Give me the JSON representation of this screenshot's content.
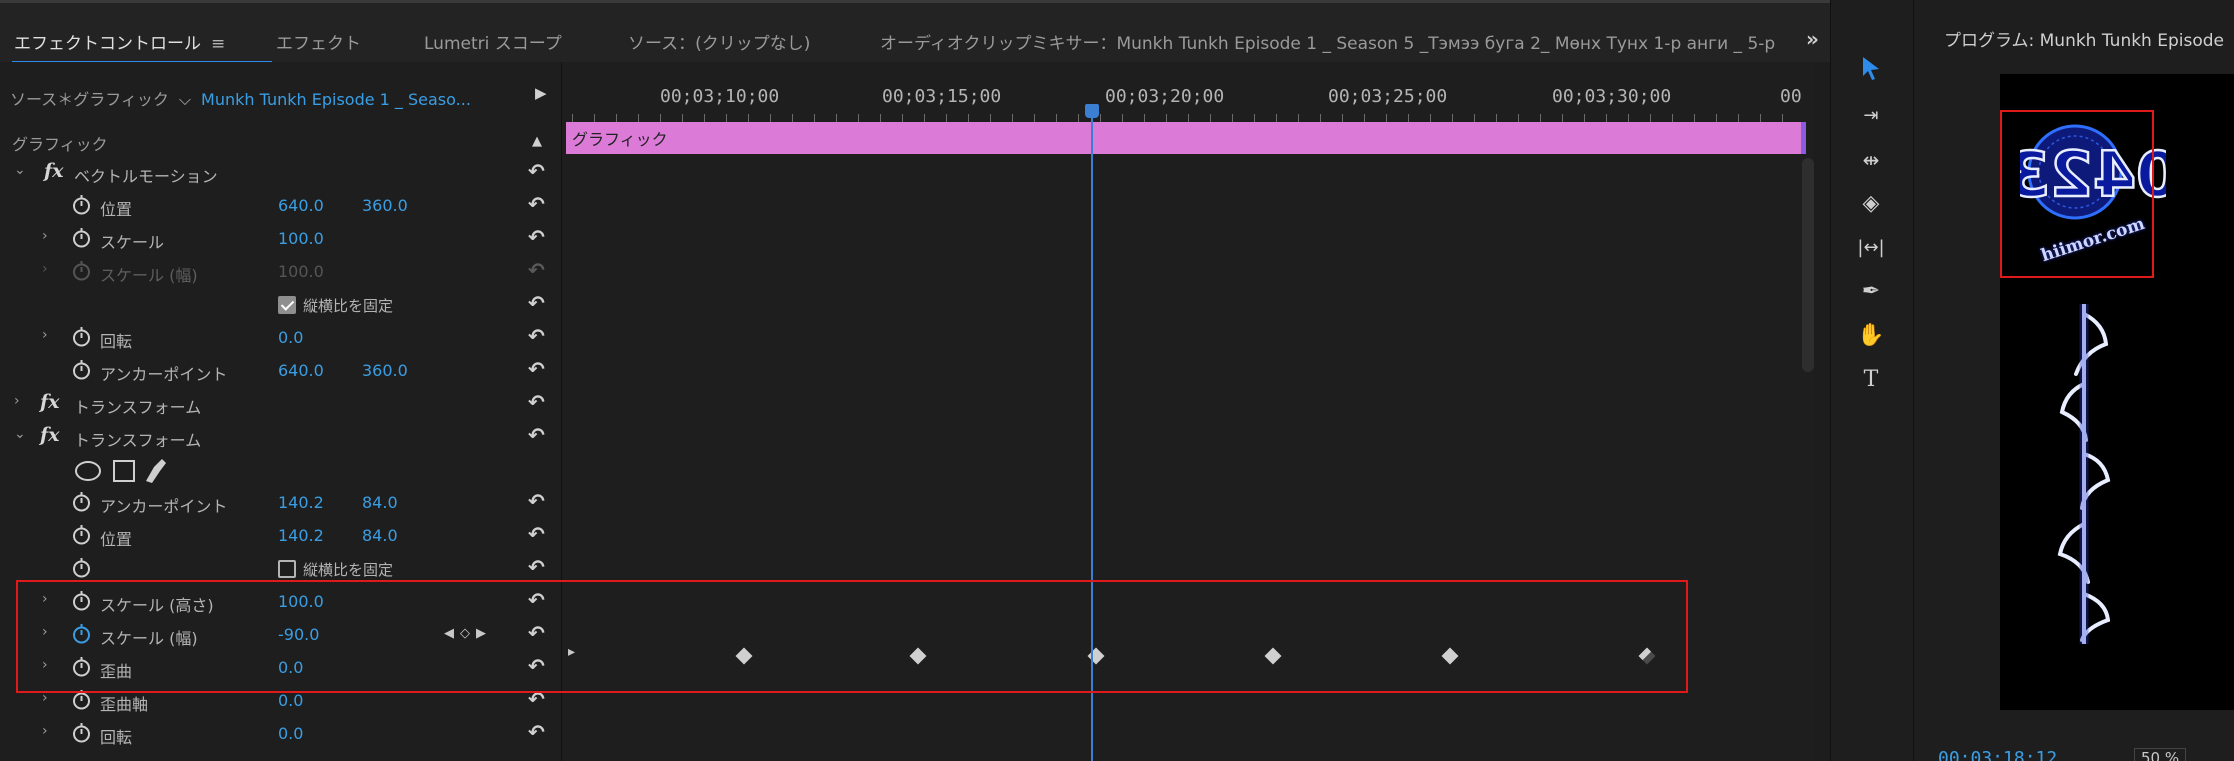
{
  "tabs": [
    {
      "label": "エフェクトコントロール",
      "active": true
    },
    {
      "label": "エフェクト"
    },
    {
      "label": "Lumetri スコープ"
    },
    {
      "label": "ソース：(クリップなし)"
    },
    {
      "label": "オーディオクリップミキサー：Munkh Tunkh Episode 1 _ Season 5 _Тэмээ буга 2_ Мөнх Тунх 1-р анги _ 5-р"
    }
  ],
  "tab_menu_icon": "≡",
  "overflow_label": "»",
  "effect_controls": {
    "source_label": "ソース＊グラフィック",
    "clip_label": "Munkh Tunkh Episode 1 _ Seaso...",
    "rows": [
      {
        "key": "graphic",
        "label": "グラフィック"
      },
      {
        "key": "vector_motion",
        "label": "ベクトルモーション"
      },
      {
        "key": "position",
        "label": "位置",
        "v1": "640.0",
        "v2": "360.0"
      },
      {
        "key": "scale",
        "label": "スケール",
        "v1": "100.0"
      },
      {
        "key": "scale_width_dim",
        "label": "スケール (幅)",
        "v1": "100.0"
      },
      {
        "key": "uniform_scale",
        "checkbox_label": "縦横比を固定",
        "checked": true
      },
      {
        "key": "rotation",
        "label": "回転",
        "v1": "0.0"
      },
      {
        "key": "anchor",
        "label": "アンカーポイント",
        "v1": "640.0",
        "v2": "360.0"
      },
      {
        "key": "transform1",
        "label": "トランスフォーム"
      },
      {
        "key": "transform2",
        "label": "トランスフォーム"
      },
      {
        "key": "mask_tools"
      },
      {
        "key": "anchor2",
        "label": "アンカーポイント",
        "v1": "140.2",
        "v2": "84.0"
      },
      {
        "key": "position2",
        "label": "位置",
        "v1": "140.2",
        "v2": "84.0"
      },
      {
        "key": "uniform_scale2",
        "checkbox_label": "縦横比を固定",
        "checked": false
      },
      {
        "key": "scale_height",
        "label": "スケール (高さ)",
        "v1": "100.0"
      },
      {
        "key": "scale_width",
        "label": "スケール (幅)",
        "v1": "-90.0"
      },
      {
        "key": "skew",
        "label": "歪曲",
        "v1": "0.0"
      },
      {
        "key": "skew_axis",
        "label": "歪曲軸",
        "v1": "0.0"
      },
      {
        "key": "rotation2",
        "label": "回転",
        "v1": "0.0"
      }
    ]
  },
  "timeline": {
    "timecodes": [
      "00;03;10;00",
      "00;03;15;00",
      "00;03;20;00",
      "00;03;25;00",
      "00;03;30;00",
      "00"
    ],
    "clip_label": "グラフィック"
  },
  "tools": [
    "selection-tool",
    "track-select-tool",
    "ripple-edit-tool",
    "razor-tool",
    "slip-tool",
    "pen-tool",
    "hand-tool",
    "type-tool"
  ],
  "program": {
    "title": "プログラム: Munkh Tunkh Episode",
    "logo_number": "0423",
    "logo_site": "hiimor.com",
    "timecode": "00;03;18;12",
    "zoom": "50 %"
  },
  "colors": {
    "accent": "#2d8ceb",
    "value_blue": "#3a9ee4",
    "clip_pink": "#dc7ad8",
    "highlight_red": "#e01a1a"
  }
}
